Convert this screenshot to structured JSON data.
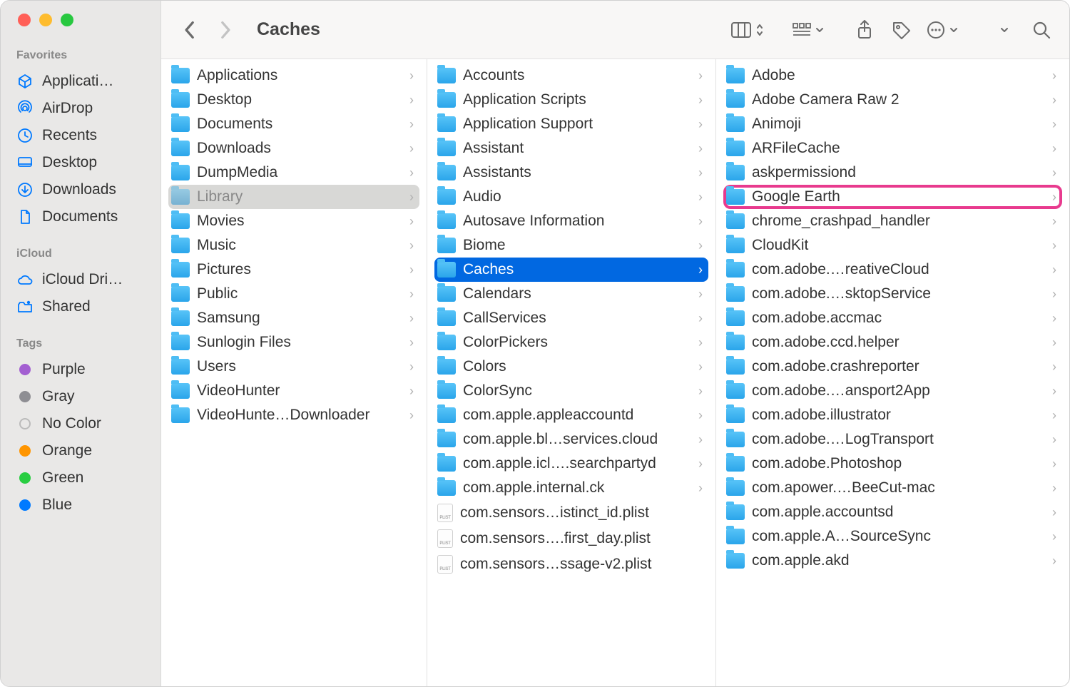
{
  "window_title": "Caches",
  "sidebar": {
    "sections": [
      {
        "title": "Favorites",
        "items": [
          {
            "icon": "applications",
            "label": "Applicati…"
          },
          {
            "icon": "airdrop",
            "label": "AirDrop"
          },
          {
            "icon": "recents",
            "label": "Recents"
          },
          {
            "icon": "desktop",
            "label": "Desktop"
          },
          {
            "icon": "downloads",
            "label": "Downloads"
          },
          {
            "icon": "documents",
            "label": "Documents"
          }
        ]
      },
      {
        "title": "iCloud",
        "items": [
          {
            "icon": "cloud",
            "label": "iCloud Dri…"
          },
          {
            "icon": "shared",
            "label": "Shared"
          }
        ]
      },
      {
        "title": "Tags",
        "items": [
          {
            "color": "#a35fd1",
            "label": "Purple"
          },
          {
            "color": "#8e8e93",
            "label": "Gray"
          },
          {
            "color": "transparent",
            "stroke": "#bbb",
            "label": "No Color"
          },
          {
            "color": "#ff9500",
            "label": "Orange"
          },
          {
            "color": "#28cd41",
            "label": "Green"
          },
          {
            "color": "#007aff",
            "label": "Blue"
          }
        ]
      }
    ]
  },
  "columns": [
    {
      "items": [
        {
          "type": "folder",
          "label": "Applications"
        },
        {
          "type": "folder",
          "label": "Desktop"
        },
        {
          "type": "folder",
          "label": "Documents"
        },
        {
          "type": "folder",
          "label": "Downloads"
        },
        {
          "type": "folder",
          "label": "DumpMedia"
        },
        {
          "type": "folder",
          "label": "Library",
          "selected": "grey"
        },
        {
          "type": "folder",
          "label": "Movies"
        },
        {
          "type": "folder",
          "label": "Music"
        },
        {
          "type": "folder",
          "label": "Pictures"
        },
        {
          "type": "folder",
          "label": "Public"
        },
        {
          "type": "folder",
          "label": "Samsung"
        },
        {
          "type": "folder",
          "label": "Sunlogin Files"
        },
        {
          "type": "folder",
          "label": "Users"
        },
        {
          "type": "folder",
          "label": "VideoHunter"
        },
        {
          "type": "folder",
          "label": "VideoHunte…Downloader"
        }
      ]
    },
    {
      "items": [
        {
          "type": "folder",
          "label": "Accounts"
        },
        {
          "type": "folder",
          "label": "Application Scripts"
        },
        {
          "type": "folder",
          "label": "Application Support"
        },
        {
          "type": "folder",
          "label": "Assistant"
        },
        {
          "type": "folder",
          "label": "Assistants"
        },
        {
          "type": "folder",
          "label": "Audio"
        },
        {
          "type": "folder",
          "label": "Autosave Information"
        },
        {
          "type": "folder",
          "label": "Biome"
        },
        {
          "type": "folder",
          "label": "Caches",
          "selected": "blue"
        },
        {
          "type": "folder",
          "label": "Calendars"
        },
        {
          "type": "folder",
          "label": "CallServices"
        },
        {
          "type": "folder",
          "label": "ColorPickers"
        },
        {
          "type": "folder",
          "label": "Colors"
        },
        {
          "type": "folder",
          "label": "ColorSync"
        },
        {
          "type": "folder",
          "label": "com.apple.appleaccountd"
        },
        {
          "type": "folder",
          "label": "com.apple.bl…services.cloud"
        },
        {
          "type": "folder",
          "label": "com.apple.icl….searchpartyd"
        },
        {
          "type": "folder",
          "label": "com.apple.internal.ck"
        },
        {
          "type": "file",
          "label": "com.sensors…istinct_id.plist",
          "nochev": true
        },
        {
          "type": "file",
          "label": "com.sensors….first_day.plist",
          "nochev": true
        },
        {
          "type": "file",
          "label": "com.sensors…ssage-v2.plist",
          "nochev": true
        }
      ]
    },
    {
      "items": [
        {
          "type": "folder",
          "label": "Adobe"
        },
        {
          "type": "folder",
          "label": "Adobe Camera Raw 2"
        },
        {
          "type": "folder",
          "label": "Animoji"
        },
        {
          "type": "folder",
          "label": "ARFileCache"
        },
        {
          "type": "folder",
          "label": "askpermissiond"
        },
        {
          "type": "folder",
          "label": "Google Earth",
          "highlight": true
        },
        {
          "type": "folder",
          "label": "chrome_crashpad_handler"
        },
        {
          "type": "folder",
          "label": "CloudKit"
        },
        {
          "type": "folder",
          "label": "com.adobe.…reativeCloud"
        },
        {
          "type": "folder",
          "label": "com.adobe.…sktopService"
        },
        {
          "type": "folder",
          "label": "com.adobe.accmac"
        },
        {
          "type": "folder",
          "label": "com.adobe.ccd.helper"
        },
        {
          "type": "folder",
          "label": "com.adobe.crashreporter"
        },
        {
          "type": "folder",
          "label": "com.adobe.…ansport2App"
        },
        {
          "type": "folder",
          "label": "com.adobe.illustrator"
        },
        {
          "type": "folder",
          "label": "com.adobe.…LogTransport"
        },
        {
          "type": "folder",
          "label": "com.adobe.Photoshop"
        },
        {
          "type": "folder",
          "label": "com.apower.…BeeCut-mac"
        },
        {
          "type": "folder",
          "label": "com.apple.accountsd"
        },
        {
          "type": "folder",
          "label": "com.apple.A…SourceSync"
        },
        {
          "type": "folder",
          "label": "com.apple.akd"
        }
      ]
    }
  ]
}
